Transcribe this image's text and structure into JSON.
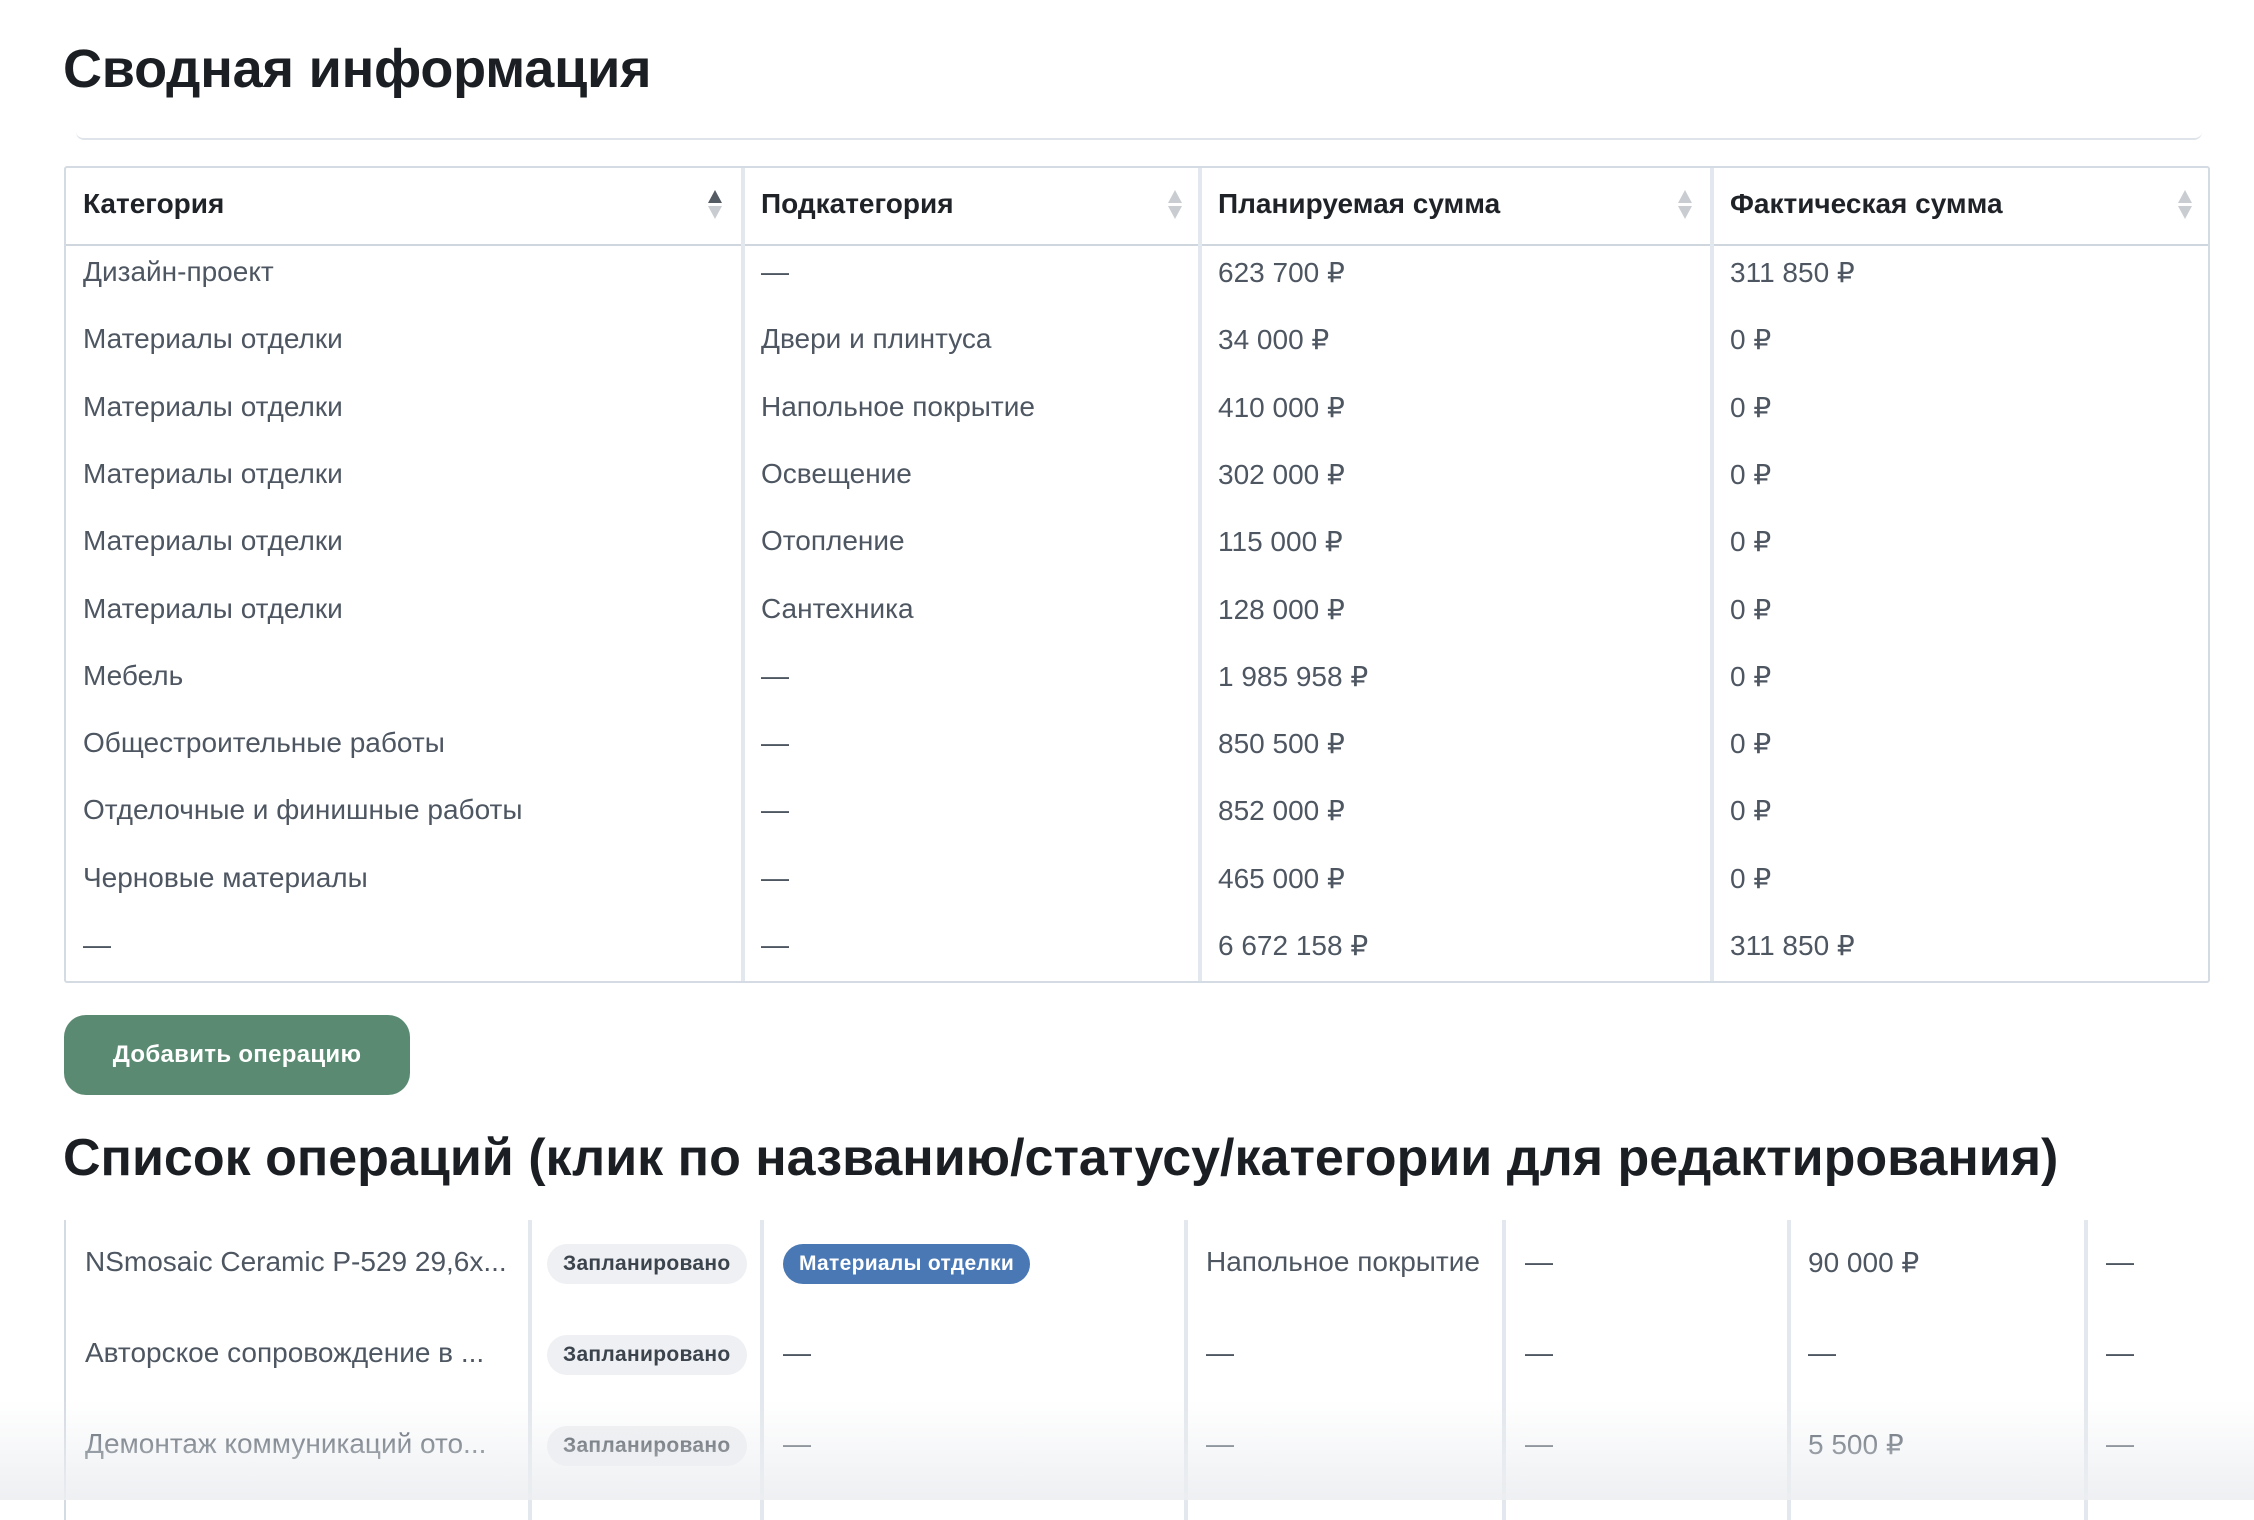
{
  "summary": {
    "title": "Сводная информация",
    "columns": [
      "Категория",
      "Подкатегория",
      "Планируемая сумма",
      "Фактическая сумма"
    ],
    "rows": [
      [
        "Дизайн-проект",
        "—",
        "623 700 ₽",
        "311 850 ₽"
      ],
      [
        "Материалы отделки",
        "Двери и плинтуса",
        "34 000 ₽",
        "0 ₽"
      ],
      [
        "Материалы отделки",
        "Напольное покрытие",
        "410 000 ₽",
        "0 ₽"
      ],
      [
        "Материалы отделки",
        "Освещение",
        "302 000 ₽",
        "0 ₽"
      ],
      [
        "Материалы отделки",
        "Отопление",
        "115 000 ₽",
        "0 ₽"
      ],
      [
        "Материалы отделки",
        "Сантехника",
        "128 000 ₽",
        "0 ₽"
      ],
      [
        "Мебель",
        "—",
        "1 985 958 ₽",
        "0 ₽"
      ],
      [
        "Общестроительные работы",
        "—",
        "850 500 ₽",
        "0 ₽"
      ],
      [
        "Отделочные и финишные работы",
        "—",
        "852 000 ₽",
        "0 ₽"
      ],
      [
        "Черновые материалы",
        "—",
        "465 000 ₽",
        "0 ₽"
      ],
      [
        "—",
        "—",
        "6 672 158 ₽",
        "311 850 ₽"
      ]
    ]
  },
  "add_button_label": "Добавить операцию",
  "operations": {
    "title": "Список операций (клик по названию/статусу/категории для редактирования)",
    "rows": [
      [
        "NSmosaic Ceramic P-529 29,6x...",
        "Запланировано",
        "Материалы отделки",
        "Напольное покрытие",
        "—",
        "90 000 ₽",
        "—"
      ],
      [
        "Авторское сопровождение в ...",
        "Запланировано",
        "—",
        "—",
        "—",
        "—",
        "—"
      ],
      [
        "Демонтаж коммуникаций ото...",
        "Запланировано",
        "—",
        "—",
        "—",
        "5 500 ₽",
        "—"
      ]
    ]
  }
}
